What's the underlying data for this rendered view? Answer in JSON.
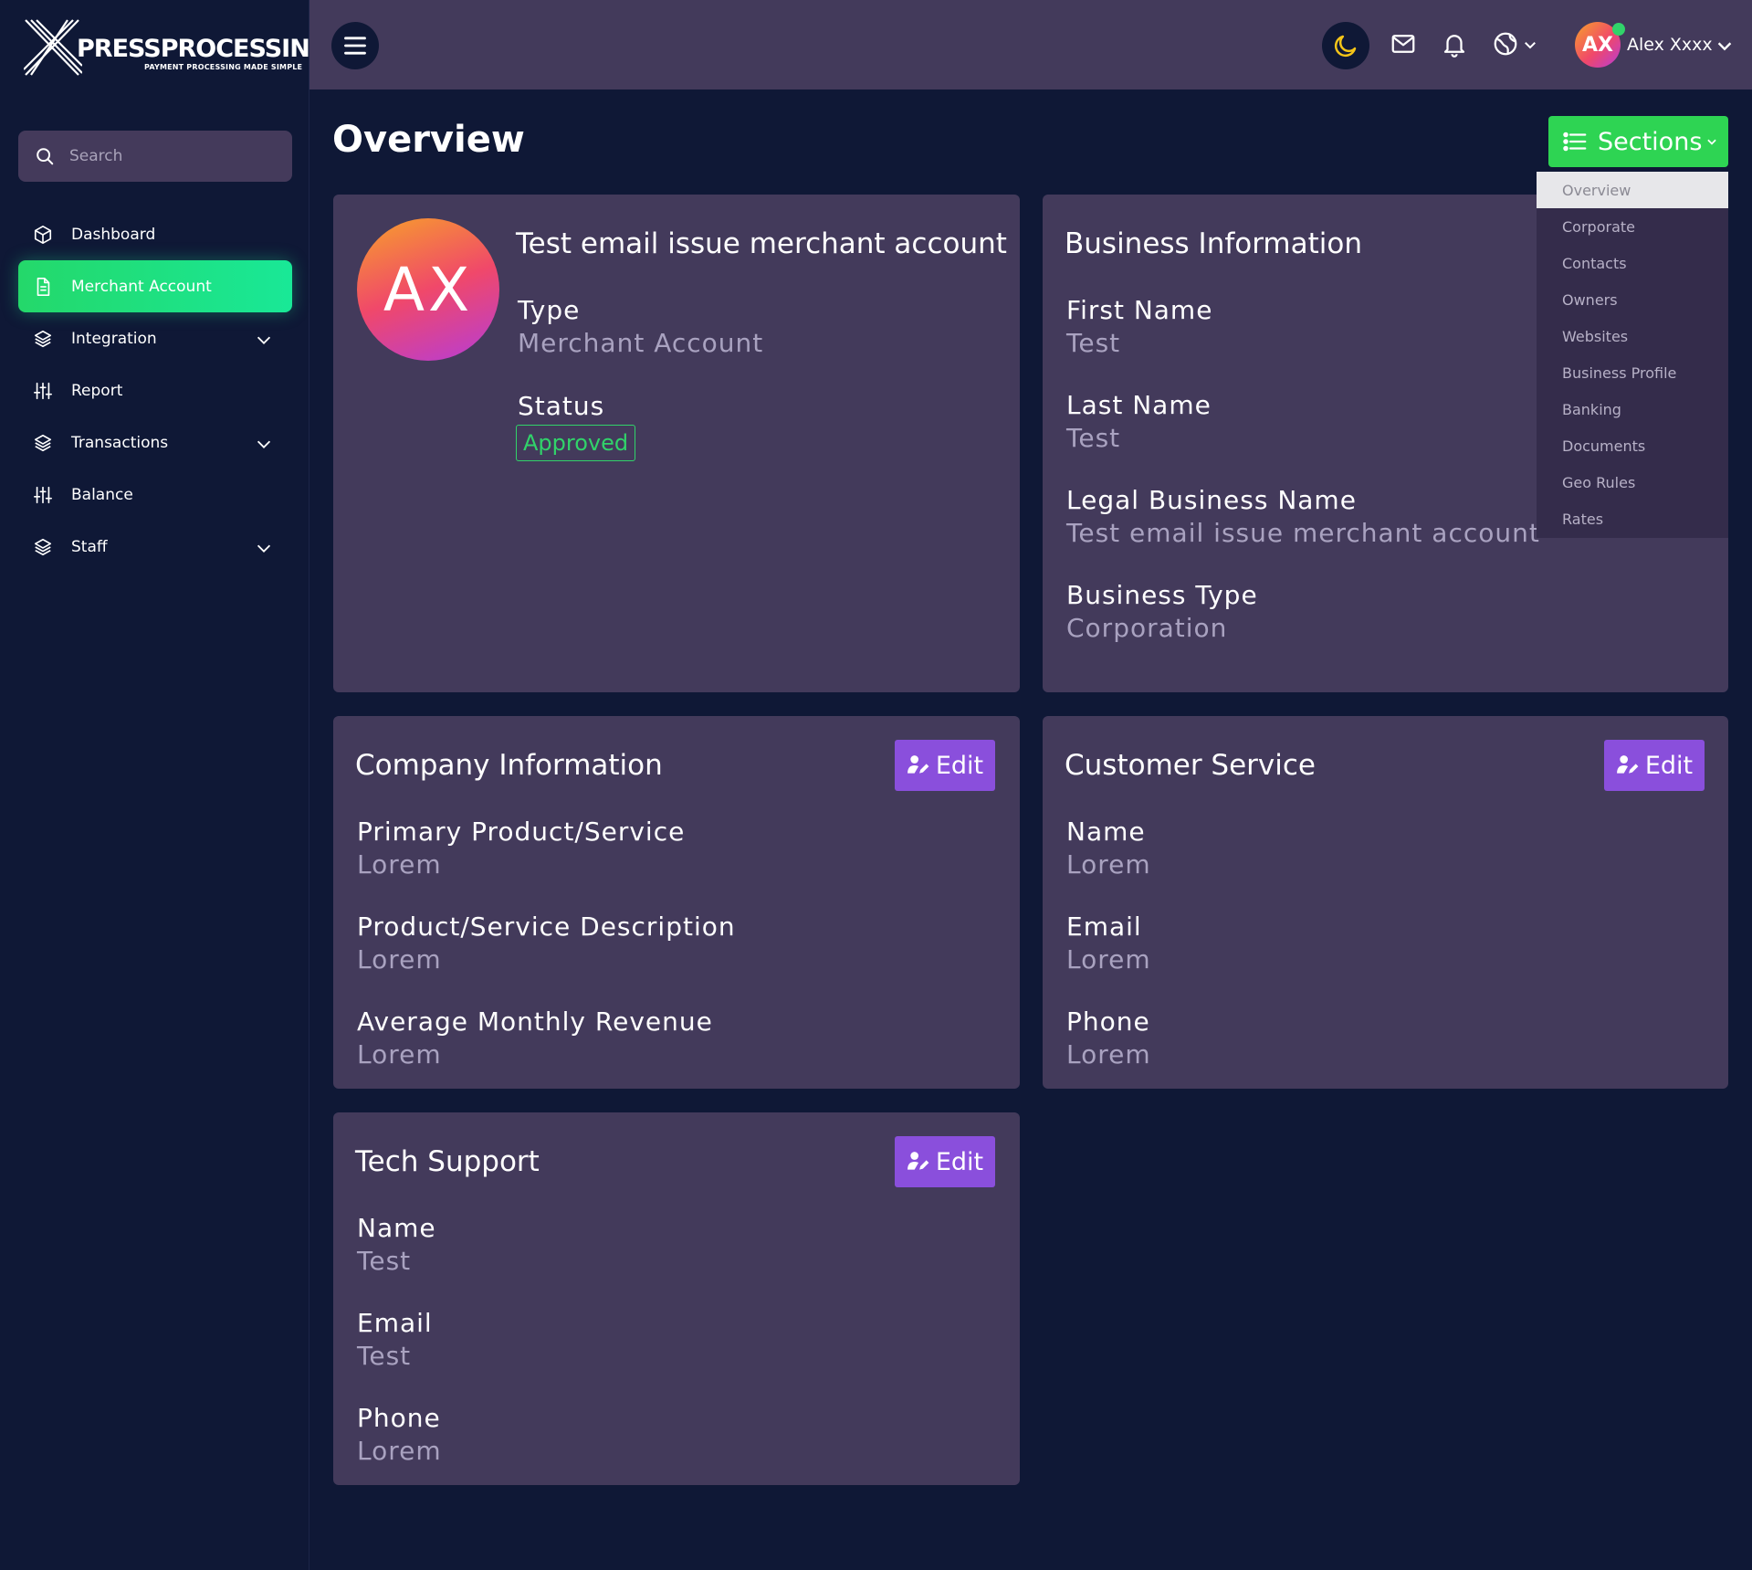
{
  "brand": {
    "name": "PRESSPROCESSING",
    "tagline": "PAYMENT PROCESSING MADE SIMPLE"
  },
  "sidebar": {
    "search_placeholder": "Search",
    "items": [
      {
        "label": "Dashboard",
        "icon": "cube-icon",
        "active": false,
        "has_children": false
      },
      {
        "label": "Merchant Account",
        "icon": "document-icon",
        "active": true,
        "has_children": false
      },
      {
        "label": "Integration",
        "icon": "layers-icon",
        "active": false,
        "has_children": true
      },
      {
        "label": "Report",
        "icon": "sliders-icon",
        "active": false,
        "has_children": false
      },
      {
        "label": "Transactions",
        "icon": "layers-icon",
        "active": false,
        "has_children": true
      },
      {
        "label": "Balance",
        "icon": "sliders-icon",
        "active": false,
        "has_children": false
      },
      {
        "label": "Staff",
        "icon": "layers-icon",
        "active": false,
        "has_children": true
      }
    ]
  },
  "topbar": {
    "user_initials": "AX",
    "user_name": "Alex Xxxx",
    "icons": [
      "menu-icon",
      "moon-icon",
      "mail-icon",
      "bell-icon",
      "globe-icon"
    ]
  },
  "page": {
    "title": "Overview",
    "sections_button": "Sections",
    "sections_menu": [
      "Overview",
      "Corporate",
      "Contacts",
      "Owners",
      "Websites",
      "Business Profile",
      "Banking",
      "Documents",
      "Geo Rules",
      "Rates"
    ],
    "sections_active": "Overview"
  },
  "overview_card": {
    "initials": "AX",
    "name": "Test email issue merchant account",
    "type_label": "Type",
    "type_value": "Merchant Account",
    "status_label": "Status",
    "status_value": "Approved"
  },
  "business_info": {
    "title": "Business Information",
    "fields": [
      {
        "label": "First Name",
        "value": "Test"
      },
      {
        "label": "Last Name",
        "value": "Test"
      },
      {
        "label": "Legal Business Name",
        "value": "Test email issue merchant account"
      },
      {
        "label": "Business Type",
        "value": "Corporation"
      }
    ]
  },
  "company_info": {
    "title": "Company Information",
    "edit_label": "Edit",
    "fields": [
      {
        "label": "Primary Product/Service",
        "value": "Lorem"
      },
      {
        "label": "Product/Service Description",
        "value": "Lorem"
      },
      {
        "label": "Average Monthly Revenue",
        "value": "Lorem"
      }
    ]
  },
  "customer_service": {
    "title": "Customer Service",
    "edit_label": "Edit",
    "fields": [
      {
        "label": "Name",
        "value": "Lorem"
      },
      {
        "label": "Email",
        "value": "Lorem"
      },
      {
        "label": "Phone",
        "value": "Lorem"
      }
    ]
  },
  "tech_support": {
    "title": "Tech Support",
    "edit_label": "Edit",
    "fields": [
      {
        "label": "Name",
        "value": "Test"
      },
      {
        "label": "Email",
        "value": "Test"
      },
      {
        "label": "Phone",
        "value": "Lorem"
      }
    ]
  },
  "colors": {
    "background": "#0f1836",
    "panel": "#433a5b",
    "accent_green": "#2ed453",
    "edit_purple": "#8a4fdc",
    "status_green": "#31d36a"
  }
}
